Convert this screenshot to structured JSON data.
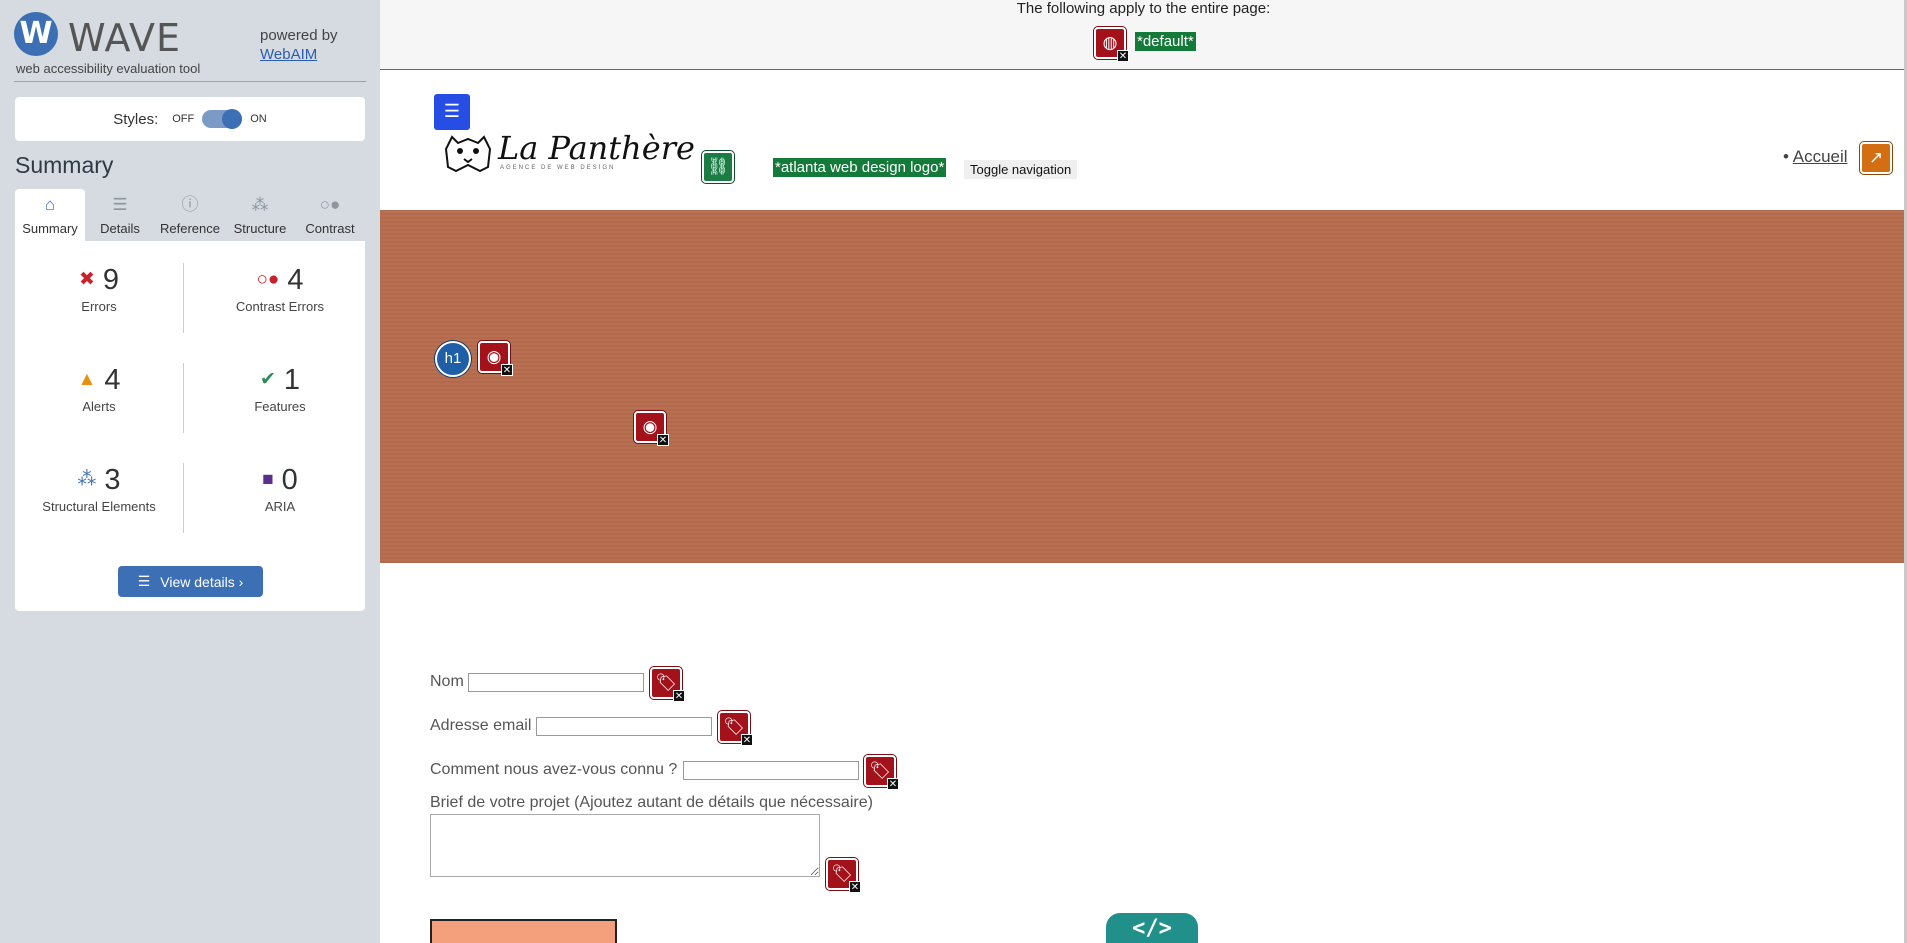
{
  "sidebar": {
    "logo_letter": "W",
    "logo_text": "WAVE",
    "logo_subtitle": "web accessibility evaluation tool",
    "powered_by": "powered by",
    "powered_link": "WebAIM",
    "styles_label": "Styles:",
    "styles_off": "OFF",
    "styles_on": "ON",
    "summary_heading": "Summary",
    "tabs": [
      {
        "label": "Summary",
        "icon": "home-icon"
      },
      {
        "label": "Details",
        "icon": "list-icon"
      },
      {
        "label": "Reference",
        "icon": "info-icon"
      },
      {
        "label": "Structure",
        "icon": "structure-icon"
      },
      {
        "label": "Contrast",
        "icon": "contrast-icon"
      }
    ],
    "stats": {
      "errors": {
        "count": "9",
        "label": "Errors"
      },
      "contrast_errors": {
        "count": "4",
        "label": "Contrast Errors"
      },
      "alerts": {
        "count": "4",
        "label": "Alerts"
      },
      "features": {
        "count": "1",
        "label": "Features"
      },
      "structural": {
        "count": "3",
        "label": "Structural Elements"
      },
      "aria": {
        "count": "0",
        "label": "ARIA"
      }
    },
    "view_details": "View details ›"
  },
  "page": {
    "banner_text": "The following apply to the entire page:",
    "default_label": "*default*",
    "logo_alt_label": "*atlanta web design logo*",
    "brand_name": "La Panthère",
    "brand_tagline": "AGENCE DE WEB DESIGN",
    "toggle_nav": "Toggle navigation",
    "nav_item": "Accueil",
    "h1_badge": "h1",
    "form": {
      "nom_label": "Nom",
      "email_label": "Adresse email",
      "source_label": "Comment nous avez-vous connu ?",
      "brief_label": "Brief de votre projet (Ajoutez autant de détails que nécessaire)"
    },
    "code_button": "</>"
  },
  "colors": {
    "wave_blue": "#3c6fb4",
    "error_red": "#a3121b",
    "alert_orange": "#d36e12",
    "feature_green": "#137a3a",
    "hero_brown": "#b86d4f",
    "code_teal": "#21908a"
  }
}
